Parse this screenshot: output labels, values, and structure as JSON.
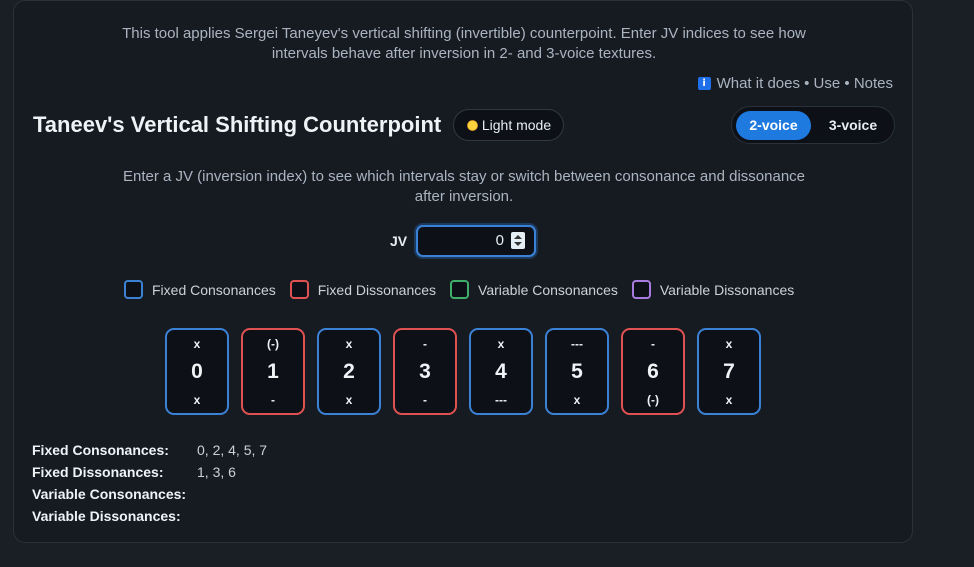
{
  "intro": "This tool applies Sergei Taneyev's vertical shifting (invertible) counterpoint. Enter JV indices to see how intervals behave after inversion in 2- and 3-voice textures.",
  "links": {
    "info_icon": "i",
    "text": "What it does • Use • Notes"
  },
  "title": "Taneev's Vertical Shifting Counterpoint",
  "light_mode_label": "Light mode",
  "voice_toggle": {
    "options": [
      "2-voice",
      "3-voice"
    ],
    "selected": "2-voice"
  },
  "subtitle": "Enter a JV (inversion index) to see which intervals stay or switch between consonance and dissonance after inversion.",
  "jv": {
    "label": "JV",
    "value": "0"
  },
  "legend": [
    {
      "label": "Fixed Consonances",
      "color": "#3b82d6"
    },
    {
      "label": "Fixed Dissonances",
      "color": "#e05252"
    },
    {
      "label": "Variable Consonances",
      "color": "#3fae6a"
    },
    {
      "label": "Variable Dissonances",
      "color": "#a77be0"
    }
  ],
  "cards": [
    {
      "top": "x",
      "num": "0",
      "bot": "x",
      "kind": "fixed-consonance"
    },
    {
      "top": "(-)",
      "num": "1",
      "bot": "-",
      "kind": "fixed-dissonance"
    },
    {
      "top": "x",
      "num": "2",
      "bot": "x",
      "kind": "fixed-consonance"
    },
    {
      "top": "-",
      "num": "3",
      "bot": "-",
      "kind": "fixed-dissonance"
    },
    {
      "top": "x",
      "num": "4",
      "bot": "---",
      "kind": "fixed-consonance"
    },
    {
      "top": "---",
      "num": "5",
      "bot": "x",
      "kind": "fixed-consonance"
    },
    {
      "top": "-",
      "num": "6",
      "bot": "(-)",
      "kind": "fixed-dissonance"
    },
    {
      "top": "x",
      "num": "7",
      "bot": "x",
      "kind": "fixed-consonance"
    }
  ],
  "summary": [
    {
      "label": "Fixed Consonances:",
      "value": "0, 2, 4, 5, 7"
    },
    {
      "label": "Fixed Dissonances:",
      "value": "1, 3, 6"
    },
    {
      "label": "Variable Consonances:",
      "value": ""
    },
    {
      "label": "Variable Dissonances:",
      "value": ""
    }
  ]
}
